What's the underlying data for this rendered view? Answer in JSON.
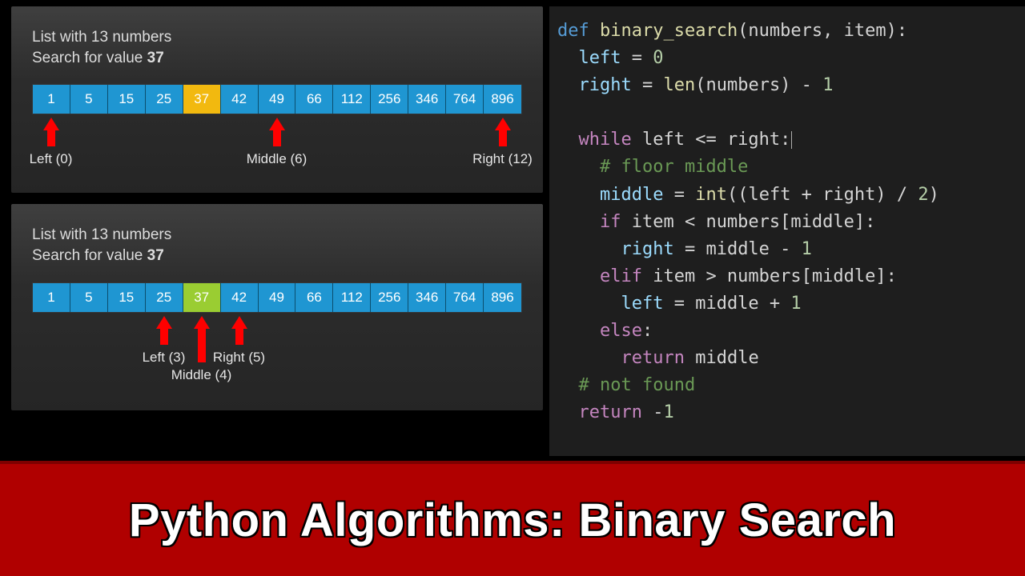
{
  "banner": {
    "title": "Python Algorithms: Binary Search"
  },
  "panel1": {
    "line1_prefix": "List with ",
    "line1_count": "13",
    "line1_suffix": " numbers",
    "line2_prefix": "Search for value ",
    "line2_value": "37",
    "values": [
      "1",
      "5",
      "15",
      "25",
      "37",
      "42",
      "49",
      "66",
      "112",
      "256",
      "346",
      "764",
      "896"
    ],
    "highlight_index": 4,
    "highlight_class": "highlight-yellow",
    "pointers": [
      {
        "idx": 0,
        "label": "Left (0)"
      },
      {
        "idx": 6,
        "label": "Middle (6)"
      },
      {
        "idx": 12,
        "label": "Right (12)"
      }
    ]
  },
  "panel2": {
    "line1_prefix": "List with ",
    "line1_count": "13",
    "line1_suffix": " numbers",
    "line2_prefix": "Search for value ",
    "line2_value": "37",
    "values": [
      "1",
      "5",
      "15",
      "25",
      "37",
      "42",
      "49",
      "66",
      "112",
      "256",
      "346",
      "764",
      "896"
    ],
    "highlight_index": 4,
    "highlight_class": "highlight-green",
    "pointers_top": [
      {
        "idx": 3,
        "label": "Left (3)"
      },
      {
        "idx": 5,
        "label": "Right (5)"
      }
    ],
    "pointer_middle": {
      "idx": 4,
      "label": "Middle (4)"
    }
  },
  "code": {
    "l1": {
      "def": "def",
      "fn": "binary_search",
      "params": "(numbers, item):"
    },
    "l2": {
      "a": "left",
      "eq": " = ",
      "v": "0"
    },
    "l3": {
      "a": "right",
      "eq": " = ",
      "len": "len",
      "rest": "(numbers) - ",
      "one": "1"
    },
    "l5": {
      "while": "while",
      "cond": " left <= right:"
    },
    "l6": {
      "cmt": "# floor middle"
    },
    "l7": {
      "a": "middle",
      "eq": " = ",
      "int": "int",
      "rest": "((left + right) / ",
      "two": "2",
      "close": ")"
    },
    "l8": {
      "if": "if",
      "cond": " item < numbers[middle]:"
    },
    "l9": {
      "a": "right",
      "eq": " = middle - ",
      "one": "1"
    },
    "l10": {
      "elif": "elif",
      "cond": " item > numbers[middle]:"
    },
    "l11": {
      "a": "left",
      "eq": " = middle + ",
      "one": "1"
    },
    "l12": {
      "else": "else",
      "colon": ":"
    },
    "l13": {
      "ret": "return",
      "sp": " middle"
    },
    "l14": {
      "cmt": "# not found"
    },
    "l15": {
      "ret": "return",
      "sp": " ",
      "neg1a": "-",
      "neg1b": "1"
    }
  }
}
